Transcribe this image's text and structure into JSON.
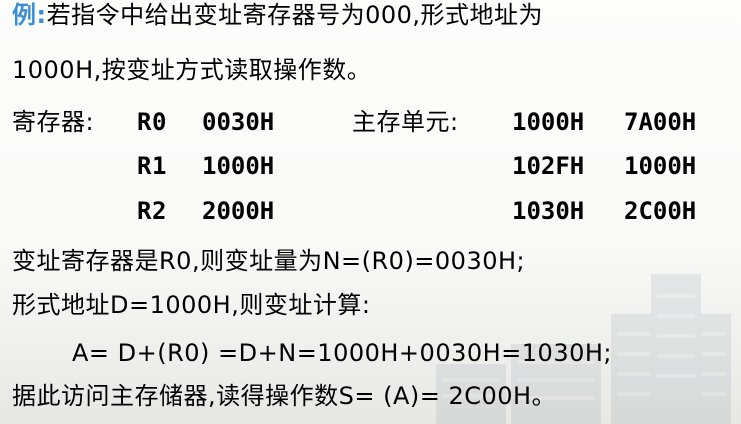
{
  "colors": {
    "accent": "#3d8fd5",
    "text": "#000000"
  },
  "problem": {
    "example_label": "例:",
    "line1_rest": "若指令中给出变址寄存器号为000,形式地址为",
    "line2": "1000H,按变址方式读取操作数。"
  },
  "registers": {
    "label": "寄存器:",
    "items": [
      {
        "name": "R0",
        "value": "0030H"
      },
      {
        "name": "R1",
        "value": "1000H"
      },
      {
        "name": "R2",
        "value": "2000H"
      }
    ]
  },
  "memory": {
    "label": "主存单元:",
    "items": [
      {
        "address": "1000H",
        "value": "7A00H"
      },
      {
        "address": "102FH",
        "value": "1000H"
      },
      {
        "address": "1030H",
        "value": "2C00H"
      }
    ]
  },
  "solution": {
    "line1": "变址寄存器是R0,则变址量为N=(R0)=0030H;",
    "line2": "形式地址D=1000H,则变址计算:",
    "line3": "A= D+(R0) =D+N=1000H+0030H=1030H;",
    "line4": "据此访问主存储器,读得操作数S= (A)= 2C00H。"
  }
}
